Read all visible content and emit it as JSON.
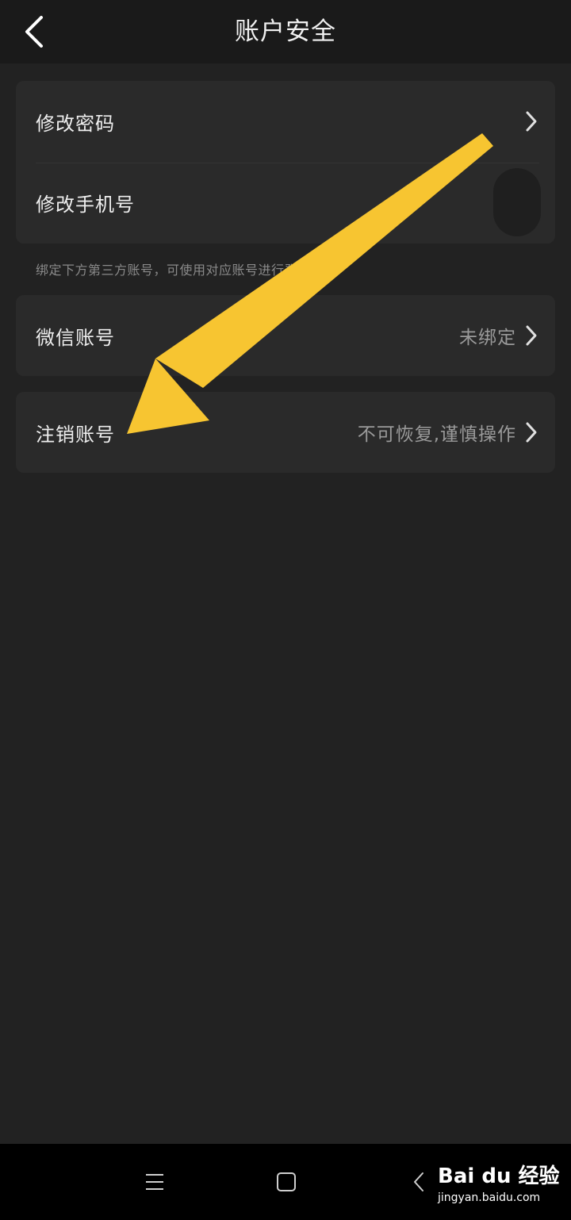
{
  "header": {
    "title": "账户安全",
    "back_icon": "chevron-left-icon"
  },
  "card_top": {
    "items": [
      {
        "label": "修改密码"
      },
      {
        "label": "修改手机号"
      }
    ]
  },
  "hint": "绑定下方第三方账号，可使用对应账号进行登",
  "wechat": {
    "label": "微信账号",
    "value": "未绑定"
  },
  "cancel": {
    "label": "注销账号",
    "value": "不可恢复,谨慎操作"
  },
  "colors": {
    "background": "#222222",
    "card": "#2a2a2a",
    "arrow": "#f7c531",
    "navbar": "#000000"
  },
  "navbar": {
    "icons": [
      "menu-icon",
      "home-square-icon",
      "back-icon"
    ]
  },
  "watermark": {
    "main": "Bai du 经验",
    "sub": "jingyan.baidu.com"
  }
}
